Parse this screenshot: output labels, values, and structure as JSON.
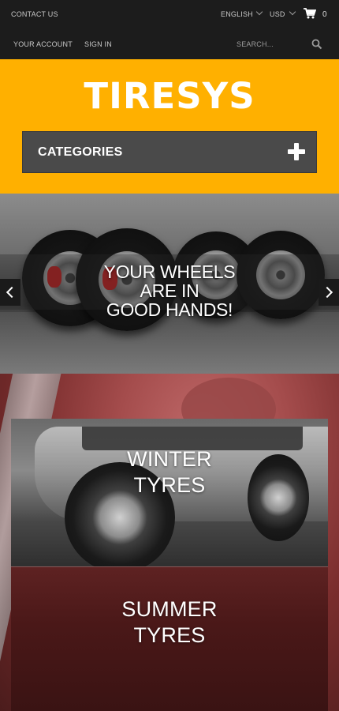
{
  "topbar": {
    "contact": "CONTACT US",
    "language": "ENGLISH",
    "currency": "USD",
    "cart_count": "0",
    "account": "YOUR ACCOUNT",
    "signin": "SIGN IN",
    "search_placeholder": "SEARCH..."
  },
  "header": {
    "logo": "TIRESYS",
    "categories_label": "CATEGORIES",
    "brand_color": "#ffb000"
  },
  "slider": {
    "caption_lines": [
      "YOUR WHEELS",
      "ARE IN",
      "GOOD HANDS!"
    ]
  },
  "banners": [
    {
      "lines": [
        "WINTER",
        "TYRES"
      ]
    },
    {
      "lines": [
        "SUMMER",
        "TYRES"
      ]
    }
  ],
  "icons": {
    "cart": "cart-icon",
    "search": "search-icon",
    "plus": "plus-icon",
    "prev": "chevron-left-icon",
    "next": "chevron-right-icon"
  }
}
